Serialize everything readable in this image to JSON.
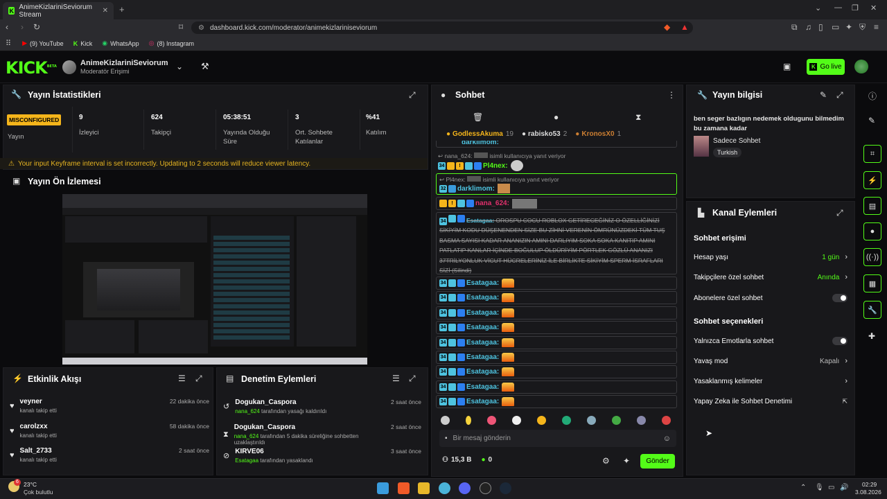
{
  "browser": {
    "tab_title": "AnimeKizlariniSeviorum Stream",
    "url": "dashboard.kick.com/moderator/animekizlariniseviorum",
    "bookmarks": [
      {
        "label": "(9) YouTube",
        "icon": "youtube-icon"
      },
      {
        "label": "Kick",
        "icon": "kick-icon"
      },
      {
        "label": "WhatsApp",
        "icon": "whatsapp-icon"
      },
      {
        "label": "(8) Instagram",
        "icon": "instagram-icon"
      }
    ]
  },
  "header": {
    "logo": "KICK",
    "logo_beta": "BETA",
    "channel_name": "AnimeKizlariniSeviorum",
    "role": "Moderatör Erişimi",
    "go_live": "Go live"
  },
  "stats": {
    "title": "Yayın İstatistikleri",
    "badge": "MISCONFIGURED",
    "badge_label": "Yayın",
    "items": [
      {
        "value": "9",
        "label": "İzleyici"
      },
      {
        "value": "624",
        "label": "Takipçi"
      },
      {
        "value": "05:38:51",
        "label": "Yayında Olduğu Süre"
      },
      {
        "value": "3",
        "label": "Ort. Sohbete Katılanlar"
      },
      {
        "value": "%41",
        "label": "Katılım"
      }
    ],
    "warning": "Your input Keyframe interval is set incorrectly. Updating to 2 seconds will reduce viewer latency."
  },
  "preview": {
    "title": "Yayın Ön İzlemesi"
  },
  "activity": {
    "title": "Etkinlik Akışı",
    "items": [
      {
        "name": "veyner",
        "sub": "kanalı takip etti",
        "time": "22 dakika önce"
      },
      {
        "name": "carolzxx",
        "sub": "kanalı takip etti",
        "time": "58 dakika önce"
      },
      {
        "name": "Salt_2733",
        "sub": "kanalı takip etti",
        "time": "2 saat önce"
      }
    ]
  },
  "moderation": {
    "title": "Denetim Eylemleri",
    "items": [
      {
        "name": "Dogukan_Caspora",
        "actor": "nana_624",
        "sub": "tarafından yasağı kaldırıldı",
        "time": "2 saat önce",
        "icon": "undo-icon"
      },
      {
        "name": "Dogukan_Caspora",
        "actor": "nana_624",
        "sub": "tarafından 5 dakika süreliğine sohbetten uzaklaştırıldı",
        "time": "2 saat önce",
        "icon": "hourglass-icon"
      },
      {
        "name": "KIRVE06",
        "actor": "Esatagaa",
        "sub": "tarafından yasaklandı",
        "time": "3 saat önce",
        "icon": "ban-icon"
      }
    ]
  },
  "chat": {
    "title": "Sohbet",
    "top_chatters": [
      {
        "name": "GodlessAkuma",
        "count": "19"
      },
      {
        "name": "rabisko53",
        "count": "2"
      },
      {
        "name": "KronosX0",
        "count": "1"
      }
    ],
    "partial_top": "darklimom:",
    "reply1_to": "nana_624:",
    "reply_note": "isimli kullanıcıya yanıt veriyor",
    "reply1_user": "Pl4nex:",
    "reply2_to": "Pl4nex:",
    "reply2_user": "darklimom:",
    "nana_user": "nana_624:",
    "long_user": "Esatagaa:",
    "long_text": "OROSPU COCU ROBLOX GETİRECEĞİNİZ O ÖZELLİĞİNİZİ SİKİYİM KODU DÜŞENENDEN SİZE BU ZİHNİ VERENİN ÖMRÜNÜZDEKİ TÜM TUŞ BASMA SAYISI KADAR ANANIZIN AMINI DARLIYIM SOKA SOKA KANITIP AMINI PATLATIP KANLAR İÇİNDE BOĞULUP ÖLDÜRİYİM PÖRTLEK GÖZLÜ ANANIZI 37TRİLYONLUK VİCUT HÜCRELERİNİZ İLE BİRLİKTE SİKİYİM SPERM İSRAFLARI SİZİ (Silindi)",
    "repeat_user": "Esatagaa:",
    "repeat_count": 9,
    "badge_num": "34",
    "input_placeholder": "Bir mesaj gönderin",
    "followers_count": "15,3 B",
    "kick_count": "0",
    "send": "Gönder"
  },
  "stream_info": {
    "title": "Yayın bilgisi",
    "stream_title": "ben seger bazlıgın nedemek oldugunu bilmedim bu zamana kadar",
    "category": "Sadece Sohbet",
    "tag": "Turkish"
  },
  "channel_actions": {
    "title": "Kanal Eylemleri",
    "chat_access": "Sohbet erişimi",
    "account_age": {
      "label": "Hesap yaşı",
      "value": "1 gün"
    },
    "followers_only": {
      "label": "Takipçilere özel sohbet",
      "value": "Anında"
    },
    "subs_only": {
      "label": "Abonelere özel sohbet"
    },
    "chat_options": "Sohbet seçenekleri",
    "emote_only": {
      "label": "Yalnızca Emotlarla sohbet"
    },
    "slow_mode": {
      "label": "Yavaş mod",
      "value": "Kapalı"
    },
    "banned_words": {
      "label": "Yasaklanmış kelimeler"
    },
    "ai_moderation": {
      "label": "Yapay Zeka ile Sohbet Denetimi"
    }
  },
  "taskbar": {
    "weather_temp": "23°C",
    "weather_desc": "Çok bulutlu",
    "time": "02:29",
    "date": "3.08.2026",
    "notif": "6"
  },
  "colors": {
    "brand": "#53fc18",
    "panel": "#18181b",
    "bg": "#0b0b0d"
  }
}
